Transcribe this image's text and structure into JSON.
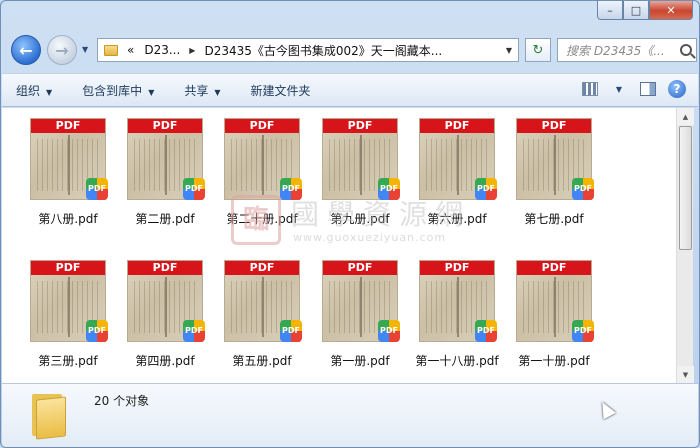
{
  "window": {
    "minimize": "–",
    "maximize": "□",
    "close": "✕"
  },
  "address": {
    "chevrons": "«",
    "crumb1": "D23...",
    "crumb2": "D23435《古今图书集成002》天一阁藏本...",
    "search_placeholder": "搜索 D23435《..."
  },
  "toolbar": {
    "organize": "组织",
    "include_library": "包含到库中",
    "share": "共享",
    "new_folder": "新建文件夹"
  },
  "files": [
    {
      "name": "第八册.pdf"
    },
    {
      "name": "第二册.pdf"
    },
    {
      "name": "第二十册.pdf"
    },
    {
      "name": "第九册.pdf"
    },
    {
      "name": "第六册.pdf"
    },
    {
      "name": "第七册.pdf"
    },
    {
      "name": "第三册.pdf"
    },
    {
      "name": "第四册.pdf"
    },
    {
      "name": "第五册.pdf"
    },
    {
      "name": "第一册.pdf"
    },
    {
      "name": "第一十八册.pdf"
    },
    {
      "name": "第一十册.pdf"
    }
  ],
  "thumb_labels": {
    "banner": "PDF",
    "badge": "PDF"
  },
  "watermark": {
    "seal": "臨",
    "title": "國學資源網",
    "url": "www.guoxueziyuan.com"
  },
  "status": {
    "count_text": "20 个对象"
  },
  "colors": {
    "pdf_banner": "#d8141b",
    "toolbar_text": "#1e395b"
  }
}
